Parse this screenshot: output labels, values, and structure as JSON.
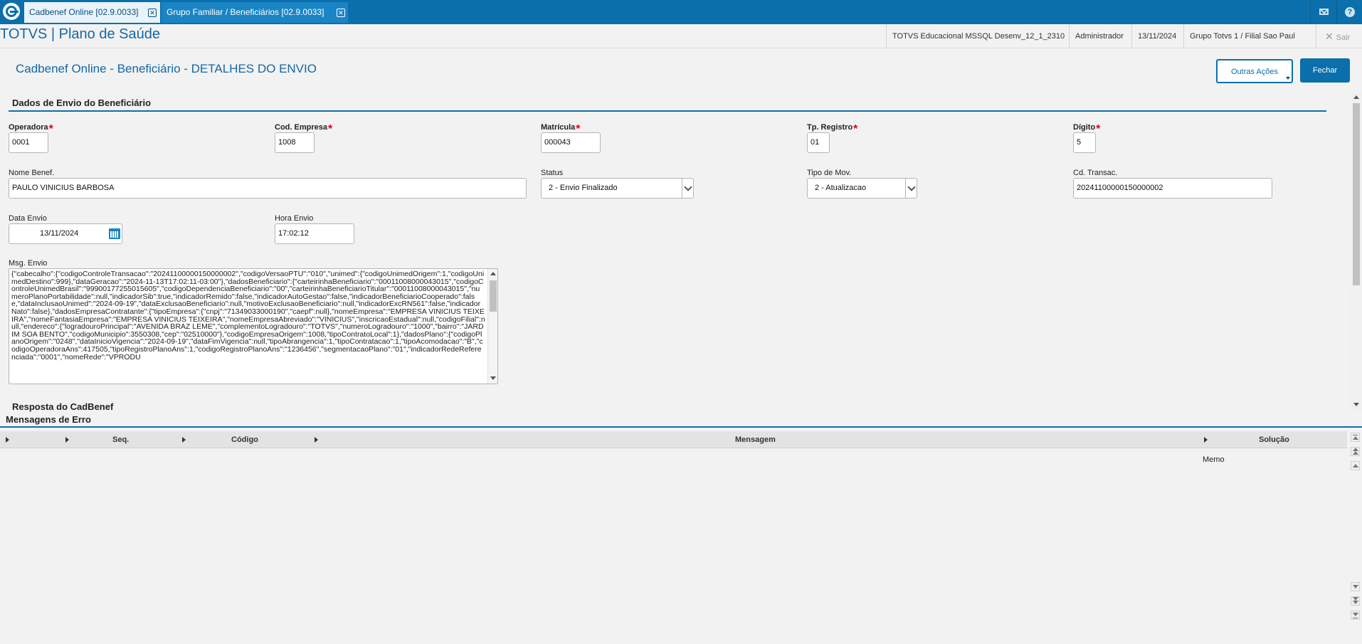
{
  "tabs": [
    {
      "label": "Cadbenef Online [02.9.0033]",
      "active": true
    },
    {
      "label": "Grupo Familiar / Beneficiários [02.9.0033]",
      "active": false
    }
  ],
  "header": {
    "app_title": "TOTVS | Plano de Saúde",
    "environment": "TOTVS Educacional MSSQL Desenv_12_1_2310",
    "user": "Administrador",
    "date": "13/11/2024",
    "branch": "Grupo Totvs 1 / Filial Sao Paul",
    "logout_label": "Sair"
  },
  "page": {
    "title": "Cadbenef Online - Beneficiário - DETALHES DO ENVIO",
    "outras_acoes_label": "Outras Ações",
    "fechar_label": "Fechar"
  },
  "section_envio": {
    "title": "Dados de Envio do Beneficiário",
    "operadora": {
      "label": "Operadora",
      "value": "0001"
    },
    "cod_empresa": {
      "label": "Cod. Empresa",
      "value": "1008"
    },
    "matricula": {
      "label": "Matrícula",
      "value": "000043"
    },
    "tp_registro": {
      "label": "Tp. Registro",
      "value": "01"
    },
    "digito": {
      "label": "Dígito",
      "value": "5"
    },
    "nome_benef": {
      "label": "Nome Benef.",
      "value": "PAULO VINICIUS BARBOSA"
    },
    "status": {
      "label": "Status",
      "value": "2 - Envio Finalizado"
    },
    "tipo_mov": {
      "label": "Tipo de Mov.",
      "value": "2 - Atualizacao"
    },
    "cd_transac": {
      "label": "Cd. Transac.",
      "value": "20241100000150000002"
    },
    "data_envio": {
      "label": "Data Envio",
      "value": "13/11/2024"
    },
    "hora_envio": {
      "label": "Hora Envio",
      "value": "17:02:12"
    },
    "msg_envio": {
      "label": "Msg. Envio",
      "value": "{\"cabecalho\":{\"codigoControleTransacao\":\"20241100000150000002\",\"codigoVersaoPTU\":\"010\",\"unimed\":{\"codigoUnimedOrigem\":1,\"codigoUnimedDestino\":999},\"dataGeracao\":\"2024-11-13T17:02:11-03:00\"},\"dadosBeneficiario\":{\"carteirinhaBeneficiario\":\"00011008000043015\",\"codigoControleUnimedBrasil\":\"99900177255015605\",\"codigoDependenciaBeneficiario\":\"00\",\"carteirinhaBeneficiarioTitular\":\"00011008000043015\",\"numeroPlanoPortabilidade\":null,\"indicadorSib\":true,\"indicadorRemido\":false,\"indicadorAutoGestao\":false,\"indicadorBeneficiarioCooperado\":false,\"dataInclusaoUnimed\":\"2024-09-19\",\"dataExclusaoBeneficiario\":null,\"motivoExclusaoBeneficiario\":null,\"indicadorExcRN561\":false,\"indicadorNato\":false},\"dadosEmpresaContratante\":{\"tipoEmpresa\":{\"cnpj\":\"71349033000190\",\"caepf\":null},\"nomeEmpresa\":\"EMPRESA VINICIUS TEIXEIRA\",\"nomeFantasiaEmpresa\":\"EMPRESA VINICIUS TEIXEIRA\",\"nomeEmpresaAbreviado\":\"VINICIUS\",\"inscricaoEstadual\":null,\"codigoFilial\":null,\"endereco\":{\"logradouroPrincipal\":\"AVENIDA BRAZ LEME\",\"complementoLogradouro\":\"TOTVS\",\"numeroLogradouro\":\"1000\",\"bairro\":\"JARDIM SOA BENTO\",\"codigoMunicipio\":3550308,\"cep\":\"02510000\"},\"codigoEmpresaOrigem\":1008,\"tipoContratoLocal\":1},\"dadosPlano\":{\"codigoPlanoOrigem\":\"0248\",\"dataInicioVigencia\":\"2024-09-19\",\"dataFimVigencia\":null,\"tipoAbrangencia\":1,\"tipoContratacao\":1,\"tipoAcomodacao\":\"B\",\"codigoOperadoraAns\":417505,\"tipoRegistroPlanoAns\":1,\"codigoRegistroPlanoAns\":\"1236456\",\"segmentacaoPlano\":\"01\",\"indicadorRedeReferenciada\":\"0001\",\"nomeRede\":\"VPRODU"
    }
  },
  "section_resposta": {
    "title": "Resposta do CadBenef",
    "subtitle": "Mensagens de Erro",
    "columns": [
      "Seq.",
      "Código",
      "Mensagem",
      "Solução"
    ],
    "rows": [
      {
        "solucao": "Memo"
      }
    ]
  }
}
